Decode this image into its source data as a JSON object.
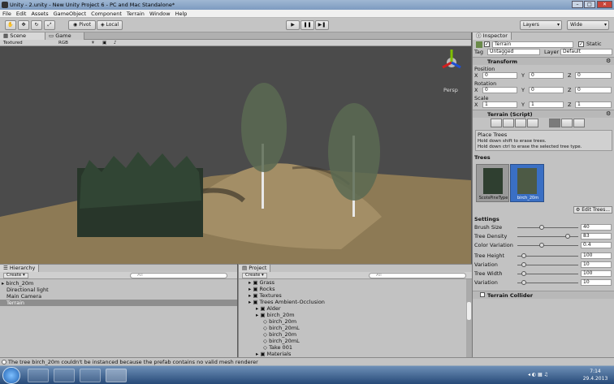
{
  "window": {
    "title": "Unity - 2.unity - New Unity Project 6 - PC and Mac Standalone*",
    "buttons": [
      "–",
      "□",
      "✕"
    ]
  },
  "menu": [
    "File",
    "Edit",
    "Assets",
    "GameObject",
    "Component",
    "Terrain",
    "Window",
    "Help"
  ],
  "toolbar": {
    "pivot": "Pivot",
    "local": "Local",
    "layers": "Layers",
    "layout": "Wide"
  },
  "scene": {
    "tabs": [
      "Scene",
      "Game"
    ],
    "render_mode": "Textured",
    "color_mode": "RGB",
    "persp_label": "Persp"
  },
  "hierarchy": {
    "tab": "Hierarchy",
    "create": "Create",
    "search": "All",
    "items": [
      "birch_20m",
      "Directional light",
      "Main Camera",
      "Terrain"
    ]
  },
  "project": {
    "tab": "Project",
    "create": "Create",
    "search": "All",
    "items": [
      {
        "label": "Grass",
        "indent": 0
      },
      {
        "label": "Rocks",
        "indent": 0
      },
      {
        "label": "Textures",
        "indent": 0
      },
      {
        "label": "Trees Ambient-Occlusion",
        "indent": 0
      },
      {
        "label": "Alder",
        "indent": 1
      },
      {
        "label": "birch_20m",
        "indent": 1
      },
      {
        "label": "birch_20m",
        "indent": 2
      },
      {
        "label": "birch_20mL",
        "indent": 2
      },
      {
        "label": "birch_20m",
        "indent": 2
      },
      {
        "label": "birch_20mL",
        "indent": 2
      },
      {
        "label": "Take 001",
        "indent": 2
      },
      {
        "label": "Materials",
        "indent": 1
      }
    ]
  },
  "inspector": {
    "tab": "Inspector",
    "object_name": "Terrain",
    "static_label": "Static",
    "tag_label": "Tag",
    "tag_value": "Untagged",
    "layer_label": "Layer",
    "layer_value": "Default",
    "transform": {
      "title": "Transform",
      "position": {
        "label": "Position",
        "x": "0",
        "y": "0",
        "z": "0"
      },
      "rotation": {
        "label": "Rotation",
        "x": "0",
        "y": "0",
        "z": "0"
      },
      "scale": {
        "label": "Scale",
        "x": "1",
        "y": "1",
        "z": "1"
      }
    },
    "terrain": {
      "title": "Terrain (Script)",
      "hint_title": "Place Trees",
      "hint_line1": "Hold down shift to erase trees.",
      "hint_line2": "Hold down ctrl to erase the selected tree type.",
      "trees_label": "Trees",
      "tree_prototypes": [
        "ScotsPineType",
        "birch_20m"
      ],
      "edit_trees": "Edit Trees...",
      "settings_label": "Settings",
      "settings": [
        {
          "label": "Brush Size",
          "value": "40",
          "fraction": 0.4
        },
        {
          "label": "Tree Density",
          "value": "83",
          "fraction": 0.83
        },
        {
          "label": "Color Variation",
          "value": "0.4",
          "fraction": 0.4
        },
        {
          "label": "Tree Height",
          "value": "100",
          "fraction": 0.1
        },
        {
          "label": "Variation",
          "value": "10",
          "fraction": 0.1
        },
        {
          "label": "Tree Width",
          "value": "100",
          "fraction": 0.1
        },
        {
          "label": "Variation",
          "value": "10",
          "fraction": 0.1
        }
      ]
    },
    "terrain_collider": "Terrain Collider"
  },
  "status": {
    "message": "The tree birch_20m couldn't be instanced because the prefab contains no valid mesh renderer"
  },
  "taskbar": {
    "time": "7:14",
    "date": "29.4.2013"
  },
  "colors": {
    "sky": "#4b4b4b",
    "terrain": "#8d7a55",
    "selection": "#3a6fc4"
  }
}
